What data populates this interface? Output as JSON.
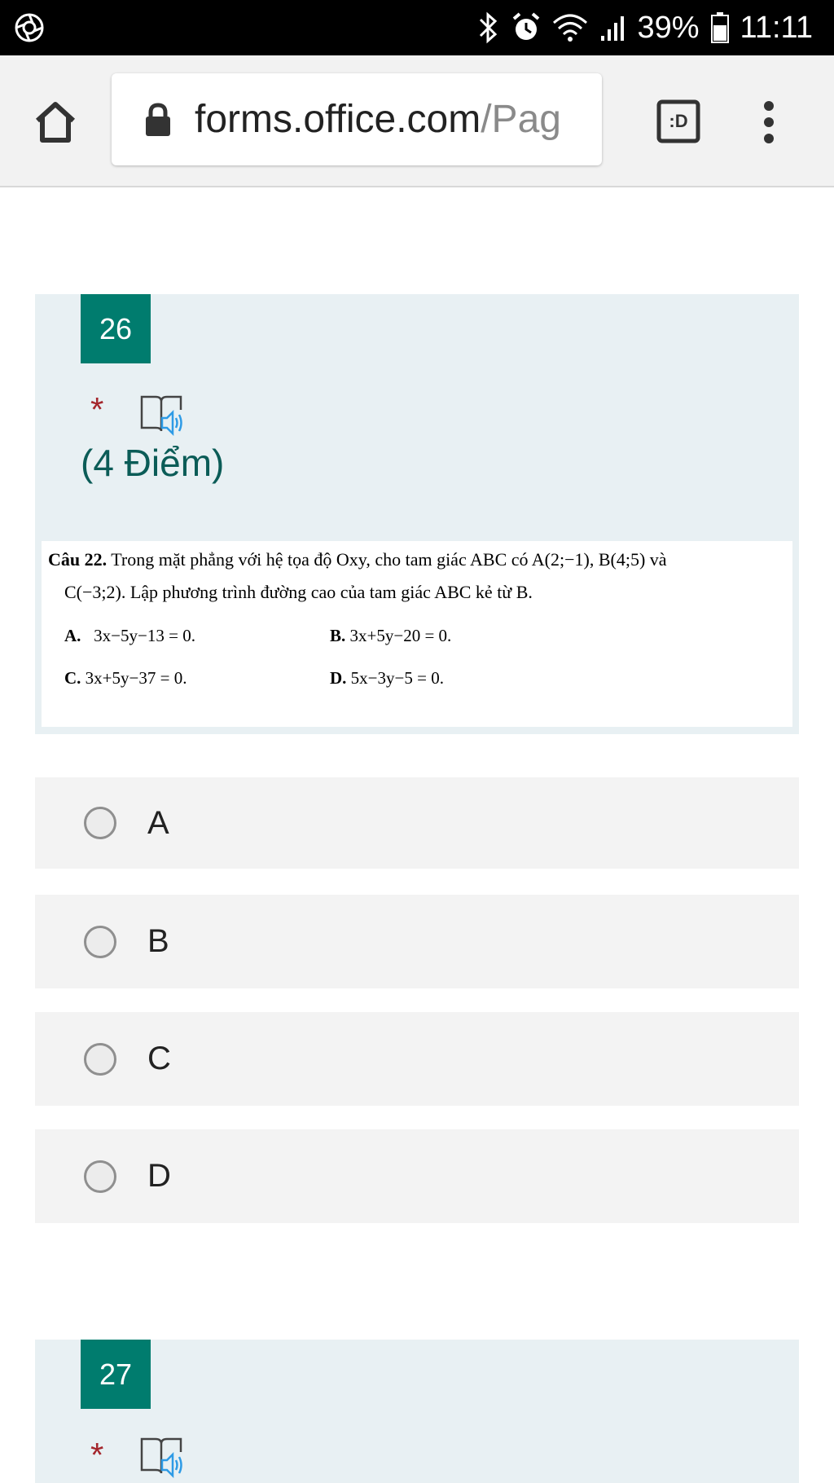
{
  "status_bar": {
    "battery": "39%",
    "time": "11:11",
    "icons": [
      "app-status-icon",
      "bluetooth-icon",
      "alarm-icon",
      "wifi-icon",
      "signal-icon",
      "battery-icon"
    ]
  },
  "browser": {
    "url_domain": "forms.office.com",
    "url_path": "/Pag",
    "icons": [
      "home-icon",
      "lock-icon",
      "tab-switcher-icon",
      "more-menu-icon"
    ],
    "tab_label": ":D"
  },
  "questions": [
    {
      "number": "26",
      "required_mark": "*",
      "points": "(4 Điểm)",
      "image_text": {
        "line1_bold": "Câu 22.",
        "line1": " Trong mặt phẳng với hệ tọa độ Oxy, cho tam giác ABC có A(2;−1), B(4;5) và",
        "line2": "C(−3;2). Lập phương trình đường cao của tam giác ABC kẻ từ B.",
        "opt_a_label": "A.",
        "opt_a": "3x−5y−13 = 0.",
        "opt_b_label": "B.",
        "opt_b": "3x+5y−20 = 0.",
        "opt_c_label": "C.",
        "opt_c": "3x+5y−37 = 0.",
        "opt_d_label": "D.",
        "opt_d": "5x−3y−5 = 0."
      },
      "choices": [
        "A",
        "B",
        "C",
        "D"
      ]
    },
    {
      "number": "27",
      "required_mark": "*"
    }
  ],
  "colors": {
    "accent": "#007c6e",
    "points_text": "#0b5c57",
    "required": "#a4262c",
    "card_bg": "#e8f0f3",
    "choice_bg": "#f3f3f3",
    "reader_icon_blue": "#2e9be6"
  }
}
